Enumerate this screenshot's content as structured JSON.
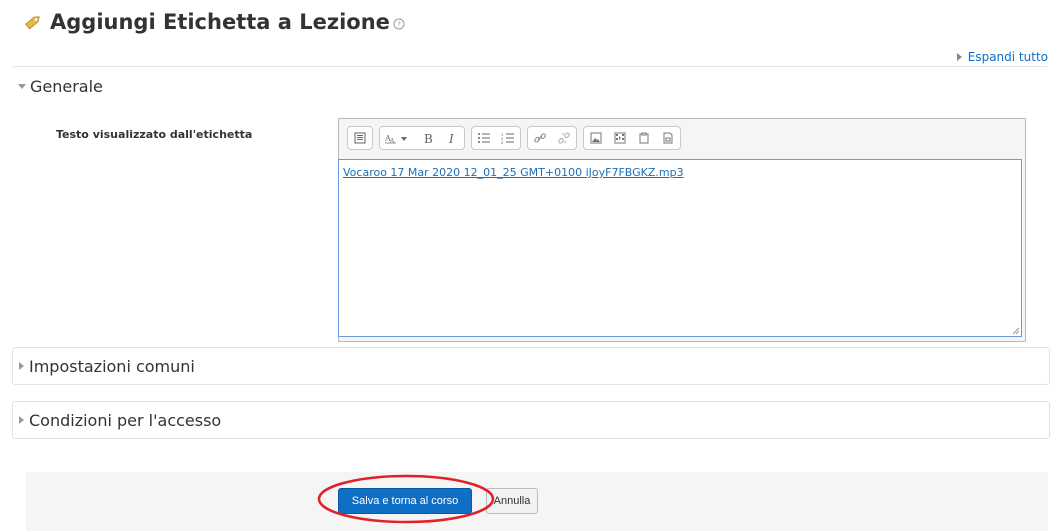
{
  "header": {
    "title": "Aggiungi Etichetta a Lezione",
    "title_icon": "tag-icon",
    "help_icon": "help-icon"
  },
  "expand_all": {
    "label": "Espandi tutto"
  },
  "sections": {
    "general": {
      "title": "Generale",
      "expanded": true
    },
    "common": {
      "title": "Impostazioni comuni",
      "expanded": false
    },
    "access": {
      "title": "Condizioni per l'accesso",
      "expanded": false
    }
  },
  "field": {
    "label": "Testo visualizzato dall'etichetta",
    "value": "Vocaroo 17 Mar 2020 12_01_25 GMT+0100 iJoyF7FBGKZ.mp3"
  },
  "toolbar": {
    "icons": [
      "toggle-toolbar-icon",
      "font-style-icon",
      "bold-icon",
      "italic-icon",
      "bullet-list-icon",
      "numbered-list-icon",
      "link-icon",
      "unlink-icon",
      "image-icon",
      "media-icon",
      "manage-files-icon",
      "record-audio-icon"
    ]
  },
  "buttons": {
    "save_return": "Salva e torna al corso",
    "cancel": "Annulla"
  },
  "colors": {
    "primary": "#0f6fc5",
    "link": "#1a6fb5",
    "annotation": "#e0202a"
  }
}
